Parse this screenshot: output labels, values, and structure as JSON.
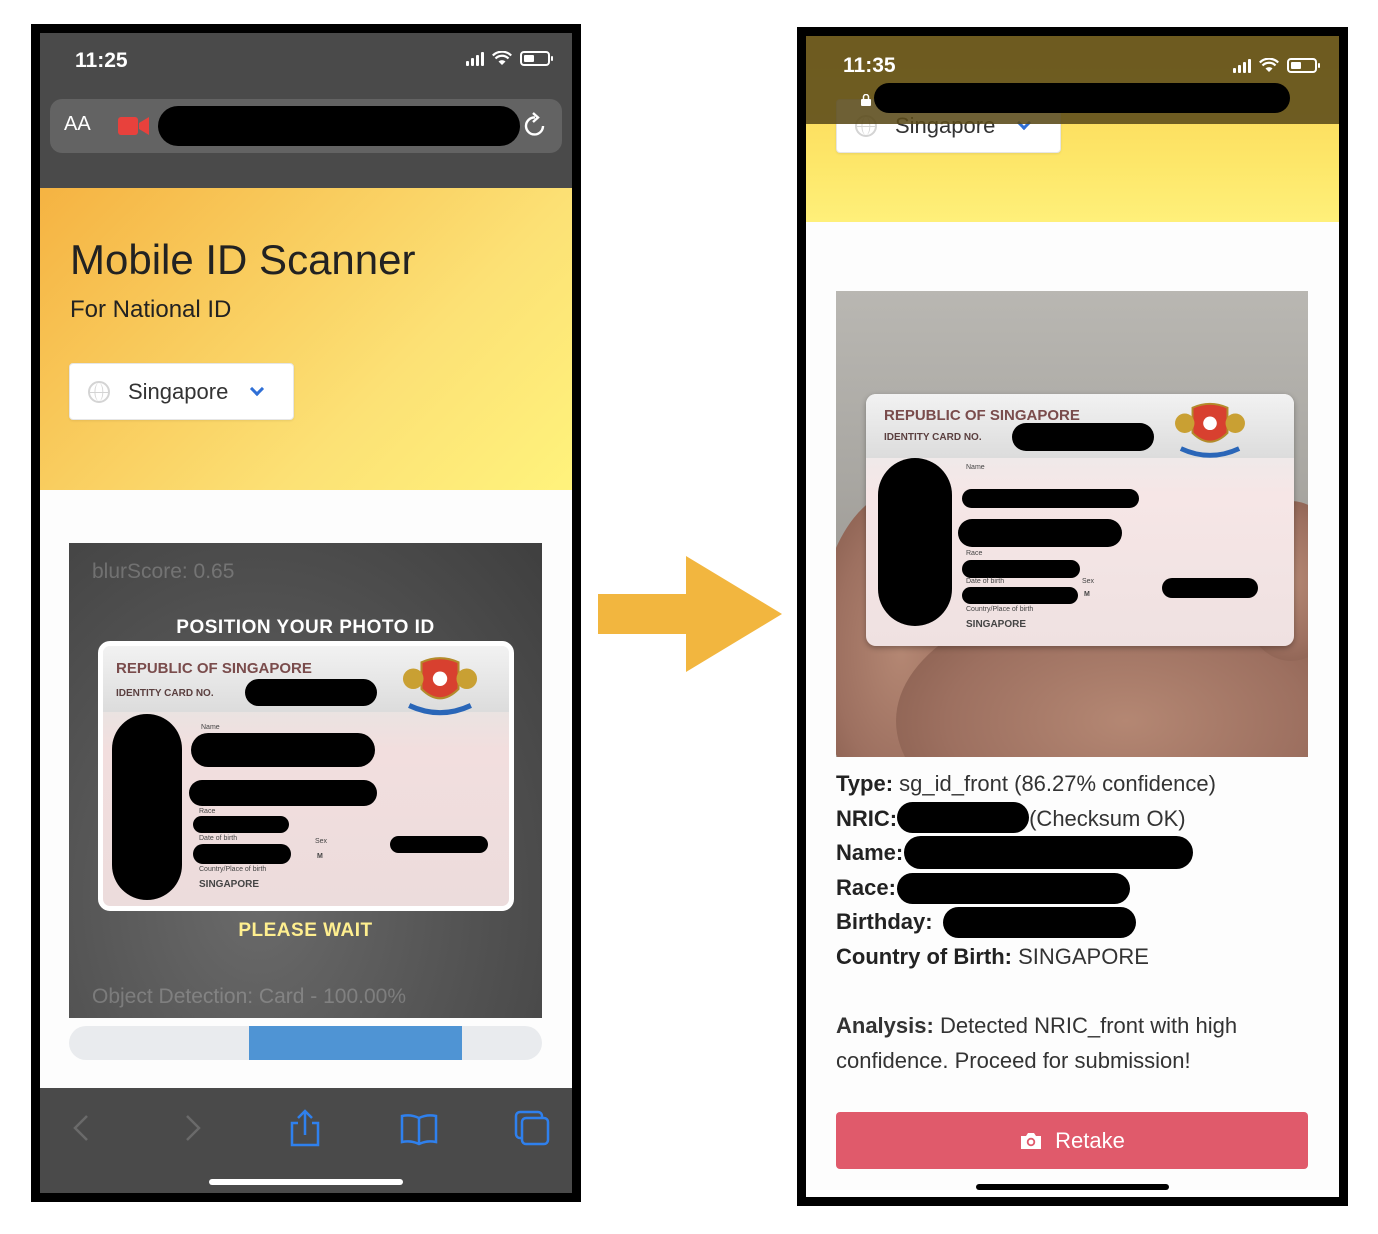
{
  "left_phone": {
    "status": {
      "time": "11:25"
    },
    "browser": {
      "aa_label": "AA"
    },
    "hero": {
      "title": "Mobile ID Scanner",
      "subtitle": "For National ID",
      "country": "Singapore"
    },
    "scanner": {
      "blur_score": "blurScore: 0.65",
      "instruction": "POSITION YOUR PHOTO ID",
      "status": "PLEASE WAIT",
      "detection": "Object Detection: Card - 100.00%",
      "progress_start": 0.38,
      "progress_end": 0.83
    },
    "card": {
      "republic": "REPUBLIC OF SINGAPORE",
      "id_no_label": "IDENTITY CARD NO.",
      "name_label": "Name",
      "race_label": "Race",
      "dob_label": "Date of birth",
      "sex_label": "Sex",
      "sex_value": "M",
      "country_label": "Country/Place of birth",
      "country_value": "SINGAPORE"
    },
    "toolbar": [
      "back-icon",
      "forward-icon",
      "share-icon",
      "bookmarks-icon",
      "tabs-icon"
    ]
  },
  "right_phone": {
    "status": {
      "time": "11:35"
    },
    "hero": {
      "country": "Singapore"
    },
    "card": {
      "republic": "REPUBLIC OF SINGAPORE",
      "id_no_label": "IDENTITY CARD NO.",
      "name_label": "Name",
      "race_label": "Race",
      "dob_label": "Date of birth",
      "sex_label": "Sex",
      "sex_value": "M",
      "country_label": "Country/Place of birth",
      "country_value": "SINGAPORE"
    },
    "results": {
      "type_label": "Type:",
      "type_value": " sg_id_front (86.27% confidence)",
      "nric_label": "NRIC:",
      "nric_status": "(Checksum OK)",
      "name_label": "Name:",
      "race_label": "Race:",
      "birthday_label": "Birthday:",
      "country_label": "Country of Birth:",
      "country_value": " SINGAPORE",
      "analysis_label": "Analysis:",
      "analysis_text": " Detected NRIC_front with high confidence. Proceed for submission!"
    },
    "retake_label": "Retake"
  },
  "colors": {
    "hero_gradient_start": "#f5b342",
    "hero_gradient_end": "#fff37c",
    "progress_fill": "#4f94d4",
    "retake_button": "#e05a6b",
    "arrow": "#f2b63f",
    "chevron": "#2f6fd6"
  }
}
